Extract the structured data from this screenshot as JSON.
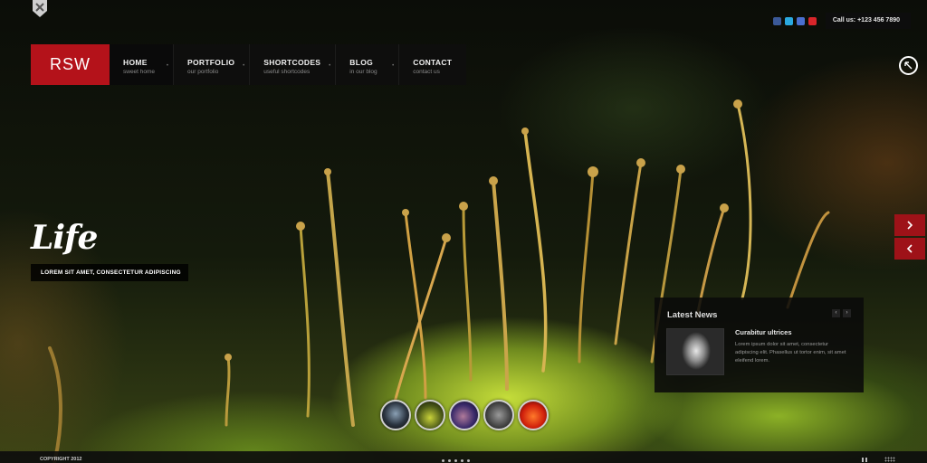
{
  "brand": {
    "logo_text": "RSW",
    "accent_color": "#b4121a"
  },
  "topbar": {
    "social_icons": [
      {
        "name": "facebook-icon",
        "color": "#3b5998"
      },
      {
        "name": "twitter-icon",
        "color": "#2aa9e0"
      },
      {
        "name": "flickr-icon",
        "color": "#4a6fd0"
      },
      {
        "name": "youtube-icon",
        "color": "#d9252a"
      }
    ],
    "phone": "Call us: +123 456 7890"
  },
  "nav": {
    "items": [
      {
        "label": "HOME",
        "sub": "sweet home"
      },
      {
        "label": "PORTFOLIO",
        "sub": "our portfolio"
      },
      {
        "label": "SHORTCODES",
        "sub": "useful shortcodes"
      },
      {
        "label": "BLOG",
        "sub": "in our blog"
      },
      {
        "label": "CONTACT",
        "sub": "contact us"
      }
    ]
  },
  "slide": {
    "title": "Life",
    "subtitle": "LOREM SIT AMET, CONSECTETUR ADIPISCING"
  },
  "news": {
    "heading": "Latest News",
    "item": {
      "title": "Curabitur ultrices",
      "text": "Lorem ipsum dolor sit amet, consectetur adipiscing elit. Phasellus ut tortor enim, sit amet eleifend lorem."
    }
  },
  "thumbnails": [
    "dancer",
    "moss",
    "bridge",
    "tunnel",
    "red"
  ],
  "footer": {
    "copyright": "COPYRIGHT 2012"
  },
  "icons": {
    "badge": "tools-icon",
    "fullscreen": "expand-icon",
    "next": "chevron-right-icon",
    "prev": "chevron-left-icon",
    "pause": "pause-icon",
    "grid": "grid-icon"
  }
}
